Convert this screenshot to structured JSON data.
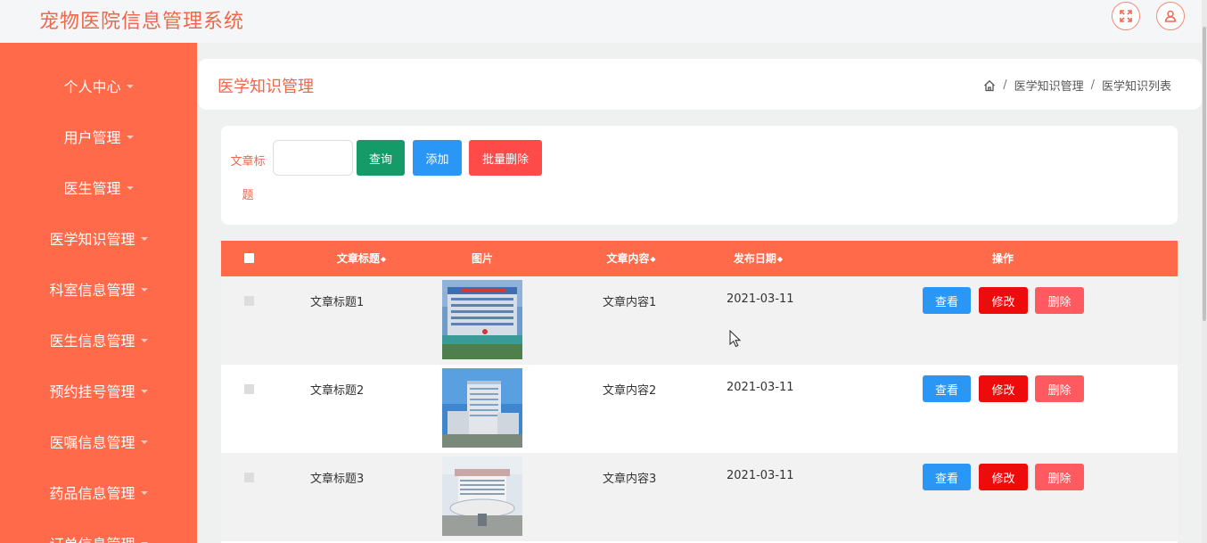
{
  "app": {
    "title": "宠物医院信息管理系统"
  },
  "topbar": {
    "fullscreen_icon": "fullscreen-icon",
    "user_icon": "user-icon"
  },
  "sidebar": {
    "items": [
      {
        "label": "个人中心"
      },
      {
        "label": "用户管理"
      },
      {
        "label": "医生管理"
      },
      {
        "label": "医学知识管理"
      },
      {
        "label": "科室信息管理"
      },
      {
        "label": "医生信息管理"
      },
      {
        "label": "预约挂号管理"
      },
      {
        "label": "医嘱信息管理"
      },
      {
        "label": "药品信息管理"
      },
      {
        "label": "订单信息管理"
      }
    ]
  },
  "page": {
    "title": "医学知识管理",
    "breadcrumb": [
      "医学知识管理",
      "医学知识列表"
    ]
  },
  "search": {
    "label": "文章标题",
    "value": "",
    "placeholder": "",
    "query_label": "查询",
    "add_label": "添加",
    "batch_delete_label": "批量删除"
  },
  "table": {
    "headers": [
      "文章标题",
      "图片",
      "文章内容",
      "发布日期",
      "操作"
    ],
    "sort_symbol": "◆",
    "rows": [
      {
        "title": "文章标题1",
        "content": "文章内容1",
        "date": "2021-03-11"
      },
      {
        "title": "文章标题2",
        "content": "文章内容2",
        "date": "2021-03-11"
      },
      {
        "title": "文章标题3",
        "content": "文章内容3",
        "date": "2021-03-11"
      }
    ],
    "actions": {
      "view": "查看",
      "edit": "修改",
      "delete": "删除"
    }
  },
  "colors": {
    "accent": "#ff6a4a",
    "title": "#f0664a",
    "query": "#159b68",
    "add": "#2a97f6",
    "delete": "#ff4a4a",
    "edit": "#ee0b0b"
  }
}
